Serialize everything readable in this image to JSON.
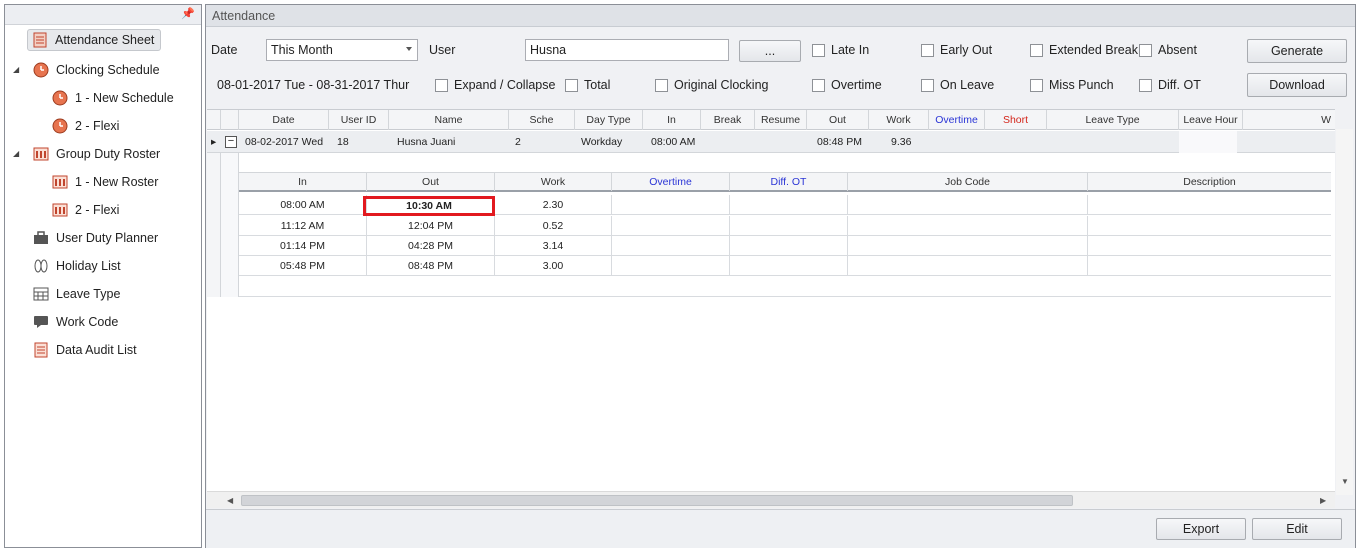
{
  "sidebar": {
    "pin_icon": "pin-icon",
    "items": [
      {
        "label": "Attendance Sheet",
        "icon": "sheet-icon"
      },
      {
        "label": "Clocking Schedule",
        "icon": "clock-icon"
      },
      {
        "label": "1 - New Schedule",
        "icon": "clock-icon"
      },
      {
        "label": "2 - Flexi",
        "icon": "clock-icon"
      },
      {
        "label": "Group Duty Roster",
        "icon": "roster-icon"
      },
      {
        "label": "1 - New Roster",
        "icon": "roster-icon"
      },
      {
        "label": "2 - Flexi",
        "icon": "roster-icon"
      },
      {
        "label": "User Duty Planner",
        "icon": "briefcase-icon"
      },
      {
        "label": "Holiday List",
        "icon": "flipflop-icon"
      },
      {
        "label": "Leave Type",
        "icon": "calendar-icon"
      },
      {
        "label": "Work Code",
        "icon": "chat-icon"
      },
      {
        "label": "Data Audit List",
        "icon": "list-icon"
      }
    ]
  },
  "main": {
    "title": "Attendance",
    "date_label": "Date",
    "date_value": "This Month",
    "user_label": "User",
    "user_value": "Husna",
    "browse_label": "...",
    "range_text": "08-01-2017 Tue - 08-31-2017 Thur",
    "checkboxes": {
      "late_in": "Late In",
      "early_out": "Early Out",
      "extended_break": "Extended Break",
      "absent": "Absent",
      "expand_collapse": "Expand / Collapse",
      "total": "Total",
      "original_clocking": "Original Clocking",
      "overtime": "Overtime",
      "on_leave": "On Leave",
      "miss_punch": "Miss Punch",
      "diff_ot": "Diff. OT"
    },
    "generate_label": "Generate",
    "download_label": "Download",
    "export_label": "Export",
    "edit_label": "Edit"
  },
  "grid": {
    "headers": [
      "Date",
      "User ID",
      "Name",
      "Sche",
      "Day Type",
      "In",
      "Break",
      "Resume",
      "Out",
      "Work",
      "Overtime",
      "Short",
      "Leave Type",
      "Leave Hour",
      "W"
    ],
    "row": {
      "date": "08-02-2017  Wed",
      "user_id": "18",
      "name": "Husna Juani",
      "sche": "2",
      "day_type": "Workday",
      "in": "08:00 AM",
      "out": "08:48 PM",
      "work": "9.36"
    },
    "sub_headers": [
      "In",
      "Out",
      "Work",
      "Overtime",
      "Diff. OT",
      "Job Code",
      "Description"
    ],
    "sub_rows": [
      [
        "08:00 AM",
        "10:30 AM",
        "2.30"
      ],
      [
        "11:12 AM",
        "12:04 PM",
        "0.52"
      ],
      [
        "01:14 PM",
        "04:28 PM",
        "3.14"
      ],
      [
        "05:48 PM",
        "08:48 PM",
        "3.00"
      ]
    ],
    "colors": {
      "overtime": "#2b35d6",
      "short": "#d4261b",
      "highlight": "#e2191f"
    }
  }
}
